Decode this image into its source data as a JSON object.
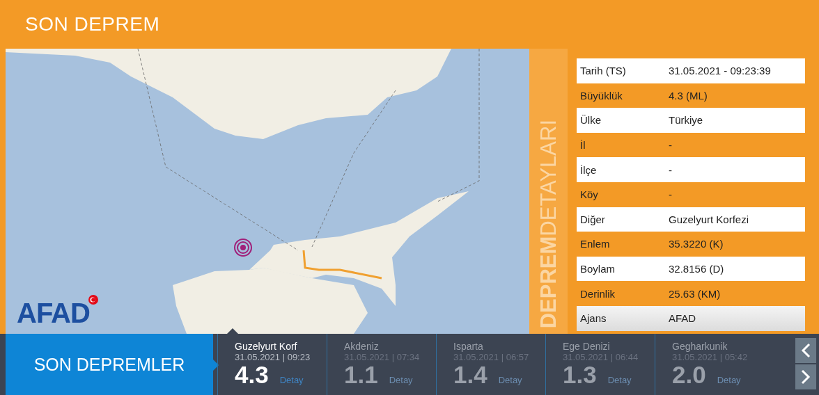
{
  "header": {
    "title": "SON DEPREM"
  },
  "map": {
    "logo": "AFAD"
  },
  "details": {
    "side_title": "**DEPREM**DETAYLARI",
    "rows": [
      {
        "label": "Tarih (TS)",
        "value": "31.05.2021 - 09:23:39"
      },
      {
        "label": "Büyüklük",
        "value": "4.3 (ML)"
      },
      {
        "label": "Ülke",
        "value": "Türkiye"
      },
      {
        "label": "İl",
        "value": "-"
      },
      {
        "label": "İlçe",
        "value": "-"
      },
      {
        "label": "Köy",
        "value": "-"
      },
      {
        "label": "Diğer",
        "value": "Guzelyurt Korfezi"
      },
      {
        "label": "Enlem",
        "value": "35.3220 (K)"
      },
      {
        "label": "Boylam",
        "value": "32.8156 (D)"
      },
      {
        "label": "Derinlik",
        "value": "25.63 (KM)"
      },
      {
        "label": "Ajans",
        "value": "AFAD"
      }
    ]
  },
  "recent": {
    "title": "SON DEPREMLER",
    "items": [
      {
        "place": "Guzelyurt Korf",
        "time": "31.05.2021 | 09:23",
        "magnitude": "4.3",
        "link": "Detay",
        "selected": true
      },
      {
        "place": "Akdeniz",
        "time": "31.05.2021 | 07:34",
        "magnitude": "1.1",
        "link": "Detay",
        "selected": false
      },
      {
        "place": "Isparta",
        "time": "31.05.2021 | 06:57",
        "magnitude": "1.4",
        "link": "Detay",
        "selected": false
      },
      {
        "place": "Ege Denizi",
        "time": "31.05.2021 | 06:44",
        "magnitude": "1.3",
        "link": "Detay",
        "selected": false
      },
      {
        "place": "Gegharkunik",
        "time": "31.05.2021 | 05:42",
        "magnitude": "2.0",
        "link": "Detay",
        "selected": false
      }
    ]
  }
}
